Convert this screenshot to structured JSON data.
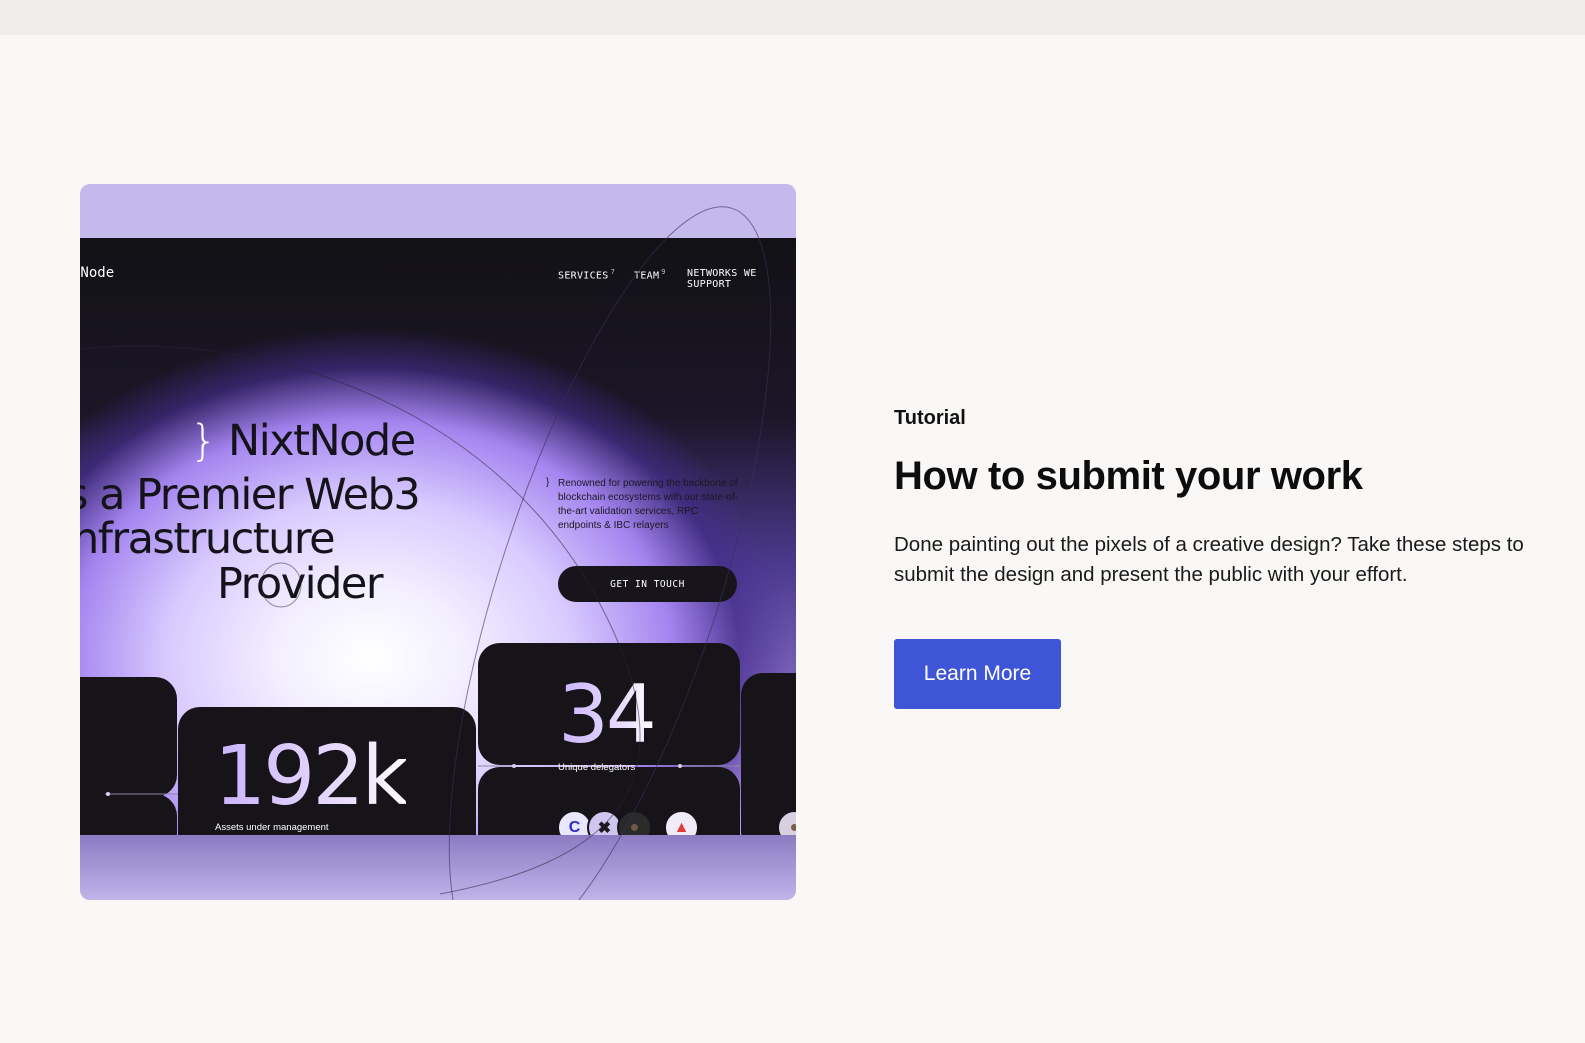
{
  "preview": {
    "logo": "tNode",
    "nav": [
      {
        "label": "SERVICES",
        "count": "7"
      },
      {
        "label": "TEAM",
        "count": "9"
      },
      {
        "label": "NETWORKS WE SUPPORT",
        "count": ""
      }
    ],
    "headline": {
      "line1": "NixtNode",
      "brace": "}",
      "line2": "s a Premier Web3",
      "line3": "nfrastructure",
      "line4": "Provider"
    },
    "description_brace": "}",
    "description": "Renowned for powering the backbone of blockchain ecosystems with our state-of-the-art validation services, RPC endpoints & IBC relayers",
    "cta_label": "GET IN TOUCH",
    "stats": [
      {
        "value": "192k",
        "caption": "Assets under management"
      },
      {
        "value": "34",
        "caption": "Unique delegators"
      }
    ],
    "accent_colors": {
      "purple": "#c4b9ec",
      "dark": "#161418"
    }
  },
  "content": {
    "eyebrow": "Tutorial",
    "title": "How to submit your work",
    "body": "Done painting out the pixels of a creative design? Take these steps to submit the design and present the public with your effort.",
    "button_label": "Learn More",
    "button_color": "#3d55d6"
  }
}
